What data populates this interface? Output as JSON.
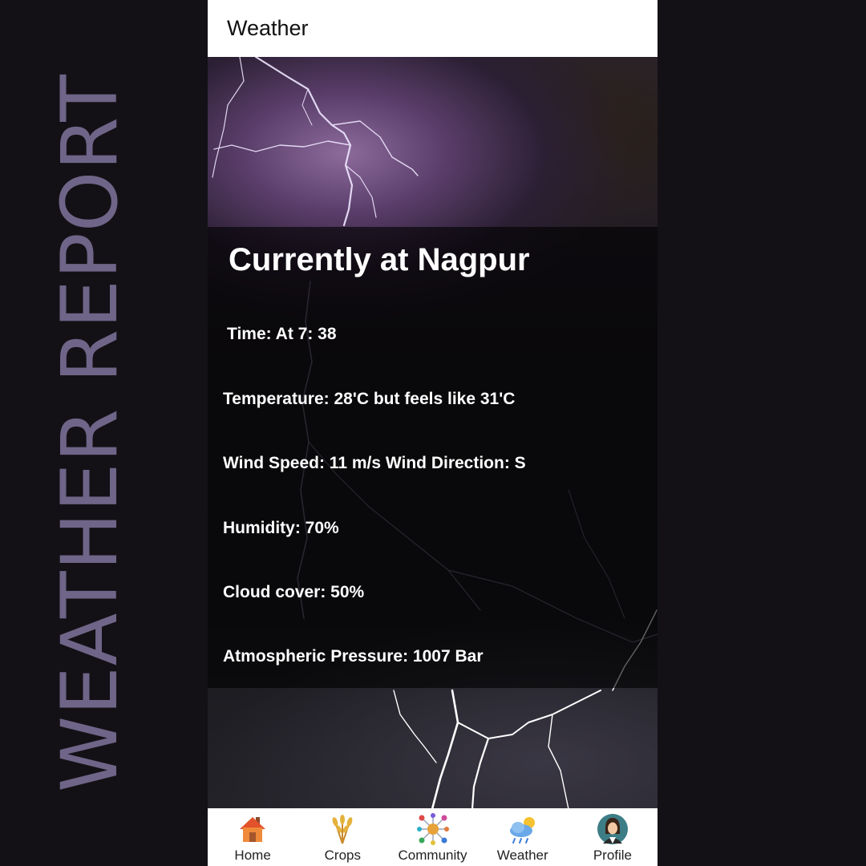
{
  "side_title": "WEATHER REPORT",
  "appbar": {
    "title": "Weather"
  },
  "main": {
    "headline": "Currently at Nagpur",
    "rows": {
      "time": "Time: At 7: 38",
      "temperature": "Temperature: 28'C but feels like 31'C",
      "wind": "Wind Speed: 11 m/s Wind Direction: S",
      "humidity": "Humidity: 70%",
      "cloud": "Cloud cover: 50%",
      "pressure": "Atmospheric Pressure: 1007 Bar"
    }
  },
  "nav": {
    "items": [
      {
        "label": "Home",
        "icon": "home-icon"
      },
      {
        "label": "Crops",
        "icon": "wheat-icon"
      },
      {
        "label": "Community",
        "icon": "network-icon"
      },
      {
        "label": "Weather",
        "icon": "cloud-sun-rain-icon"
      },
      {
        "label": "Profile",
        "icon": "avatar-icon"
      }
    ]
  },
  "colors": {
    "side_title": "#6f6588",
    "page_background": "#131116",
    "panel_overlay": "rgba(0,0,0,0.62)"
  }
}
